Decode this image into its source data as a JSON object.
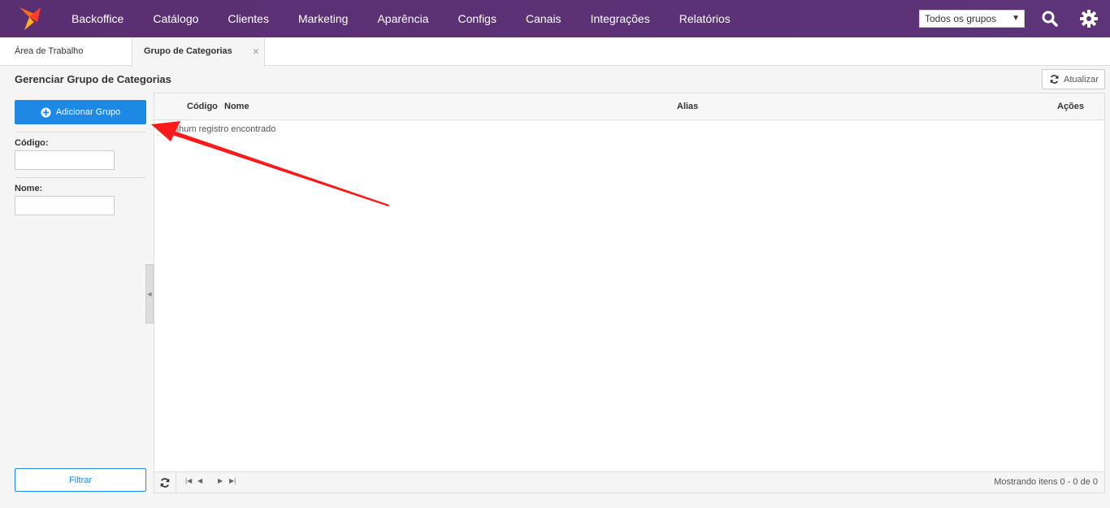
{
  "nav": {
    "items": [
      "Backoffice",
      "Catálogo",
      "Clientes",
      "Marketing",
      "Aparência",
      "Configs",
      "Canais",
      "Integrações",
      "Relatórios"
    ],
    "group_select": "Todos os grupos",
    "brand_color": "#5b3175",
    "logo_icon": "x-logo-icon",
    "search_icon": "search-icon",
    "settings_icon": "gear-icon"
  },
  "tabs": {
    "workspace": "Área de Trabalho",
    "active": "Grupo de Categorias",
    "close": "×"
  },
  "page": {
    "title": "Gerenciar Grupo de Categorias",
    "refresh_label": "Atualizar"
  },
  "sidebar": {
    "add_button": "Adicionar Grupo",
    "code_label": "Código:",
    "code_value": "",
    "name_label": "Nome:",
    "name_value": "",
    "filter_button": "Filtrar",
    "accent_color": "#1e88e5"
  },
  "grid": {
    "columns": [
      "Código",
      "Nome",
      "Alias",
      "Ações"
    ],
    "empty_message": "Nenhum registro encontrado",
    "paging_info": "Mostrando itens 0 - 0 de 0"
  },
  "annotation": {
    "arrow_color": "#ff1a1a"
  }
}
